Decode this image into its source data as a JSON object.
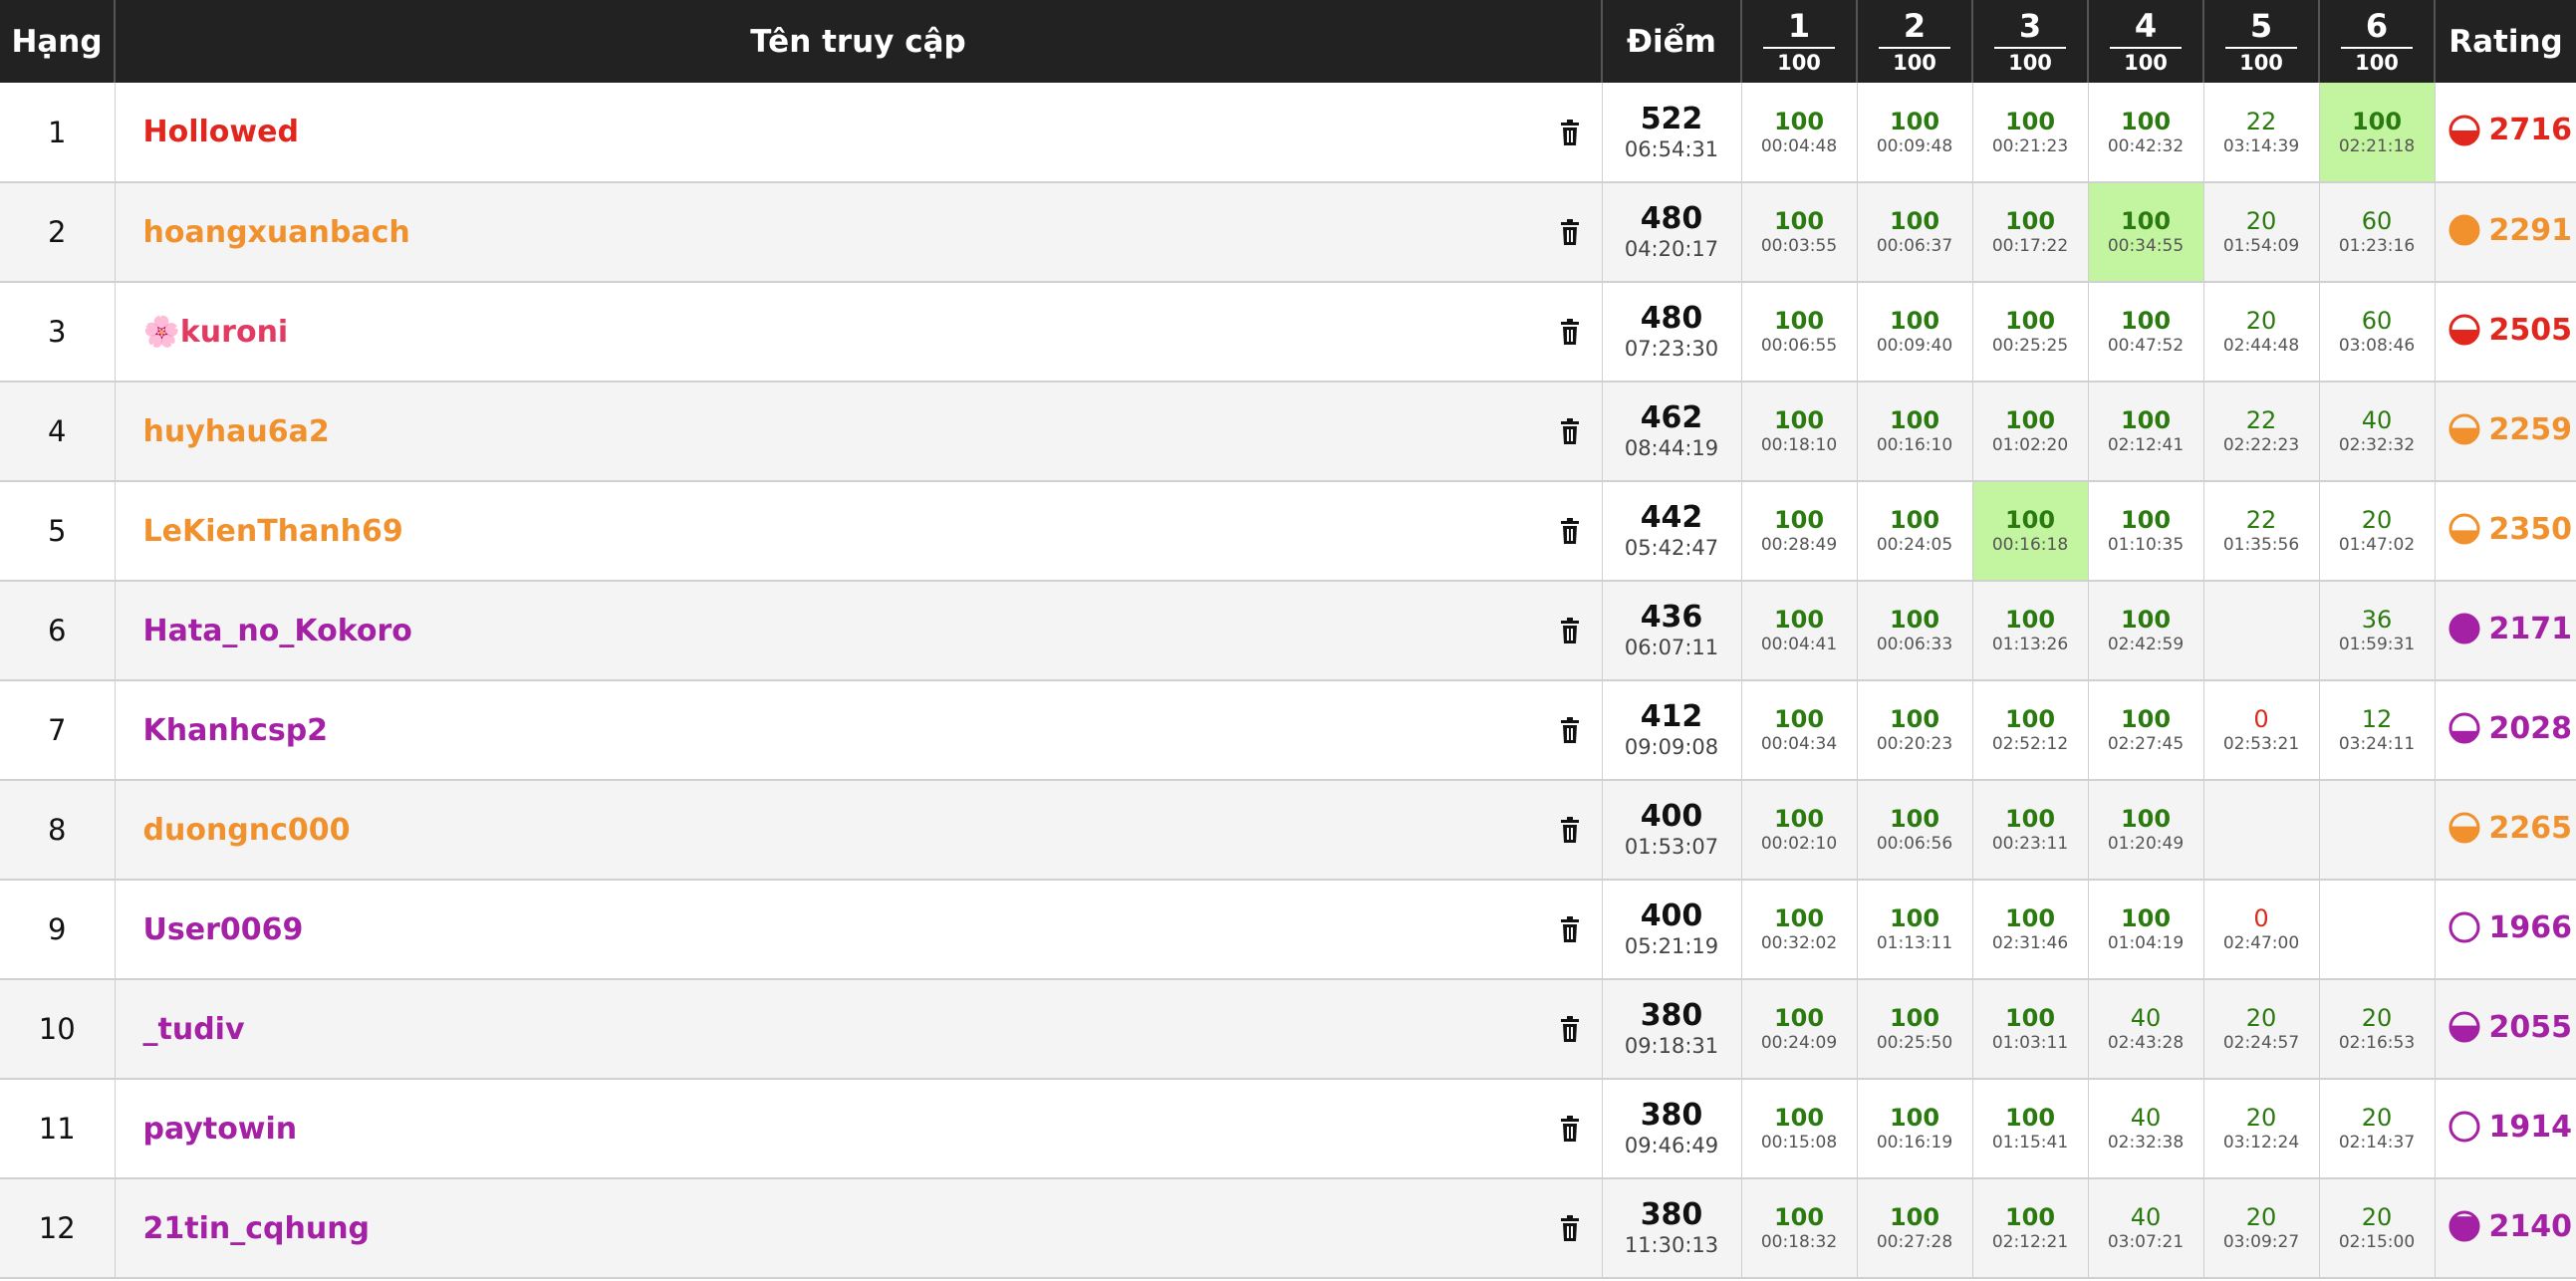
{
  "header": {
    "rank": "Hạng",
    "username": "Tên truy cập",
    "points": "Điểm",
    "problems": [
      {
        "num": "1",
        "points": "100"
      },
      {
        "num": "2",
        "points": "100"
      },
      {
        "num": "3",
        "points": "100"
      },
      {
        "num": "4",
        "points": "100"
      },
      {
        "num": "5",
        "points": "100"
      },
      {
        "num": "6",
        "points": "100"
      }
    ],
    "rating": "Rating"
  },
  "colors": {
    "red": "#e0261d",
    "orange": "#f0912e",
    "pink": "#e23b62",
    "purple": "#a420a5",
    "first_solve": "#c3f5a0",
    "header_bg": "#222222"
  },
  "icons": {
    "delete": "trash-icon"
  },
  "rows": [
    {
      "rank": "1",
      "username": "Hollowed",
      "color": "#e0261d",
      "score": "522",
      "time": "06:54:31",
      "problems": [
        {
          "score": "100",
          "time": "00:04:48"
        },
        {
          "score": "100",
          "time": "00:09:48"
        },
        {
          "score": "100",
          "time": "00:21:23"
        },
        {
          "score": "100",
          "time": "00:42:32"
        },
        {
          "score": "22",
          "time": "03:14:39"
        },
        {
          "score": "100",
          "time": "02:21:18",
          "first": true
        }
      ],
      "rating": "2716",
      "rating_color": "#e0261d",
      "rating_fill": 0.5
    },
    {
      "rank": "2",
      "username": "hoangxuanbach",
      "color": "#f0912e",
      "score": "480",
      "time": "04:20:17",
      "problems": [
        {
          "score": "100",
          "time": "00:03:55"
        },
        {
          "score": "100",
          "time": "00:06:37"
        },
        {
          "score": "100",
          "time": "00:17:22"
        },
        {
          "score": "100",
          "time": "00:34:55",
          "first": true
        },
        {
          "score": "20",
          "time": "01:54:09"
        },
        {
          "score": "60",
          "time": "01:23:16"
        }
      ],
      "rating": "2291",
      "rating_color": "#f0912e",
      "rating_fill": 1.0
    },
    {
      "rank": "3",
      "username": "kuroni",
      "prefix": "🌸",
      "color": "#e23b62",
      "score": "480",
      "time": "07:23:30",
      "problems": [
        {
          "score": "100",
          "time": "00:06:55"
        },
        {
          "score": "100",
          "time": "00:09:40"
        },
        {
          "score": "100",
          "time": "00:25:25"
        },
        {
          "score": "100",
          "time": "00:47:52"
        },
        {
          "score": "20",
          "time": "02:44:48"
        },
        {
          "score": "60",
          "time": "03:08:46"
        }
      ],
      "rating": "2505",
      "rating_color": "#e0261d",
      "rating_fill": 0.5
    },
    {
      "rank": "4",
      "username": "huyhau6a2",
      "color": "#f0912e",
      "score": "462",
      "time": "08:44:19",
      "problems": [
        {
          "score": "100",
          "time": "00:18:10"
        },
        {
          "score": "100",
          "time": "00:16:10"
        },
        {
          "score": "100",
          "time": "01:02:20"
        },
        {
          "score": "100",
          "time": "02:12:41"
        },
        {
          "score": "22",
          "time": "02:22:23"
        },
        {
          "score": "40",
          "time": "02:32:32"
        }
      ],
      "rating": "2259",
      "rating_color": "#f0912e",
      "rating_fill": 0.55
    },
    {
      "rank": "5",
      "username": "LeKienThanh69",
      "color": "#f0912e",
      "score": "442",
      "time": "05:42:47",
      "problems": [
        {
          "score": "100",
          "time": "00:28:49"
        },
        {
          "score": "100",
          "time": "00:24:05"
        },
        {
          "score": "100",
          "time": "00:16:18",
          "first": true
        },
        {
          "score": "100",
          "time": "01:10:35"
        },
        {
          "score": "22",
          "time": "01:35:56"
        },
        {
          "score": "20",
          "time": "01:47:02"
        }
      ],
      "rating": "2350",
      "rating_color": "#f0912e",
      "rating_fill": 0.45
    },
    {
      "rank": "6",
      "username": "Hata_no_Kokoro",
      "color": "#a420a5",
      "score": "436",
      "time": "06:07:11",
      "problems": [
        {
          "score": "100",
          "time": "00:04:41"
        },
        {
          "score": "100",
          "time": "00:06:33"
        },
        {
          "score": "100",
          "time": "01:13:26"
        },
        {
          "score": "100",
          "time": "02:42:59"
        },
        {
          "score": "",
          "time": ""
        },
        {
          "score": "36",
          "time": "01:59:31"
        }
      ],
      "rating": "2171",
      "rating_color": "#a420a5",
      "rating_fill": 1.0
    },
    {
      "rank": "7",
      "username": "Khanhcsp2",
      "color": "#a420a5",
      "score": "412",
      "time": "09:09:08",
      "problems": [
        {
          "score": "100",
          "time": "00:04:34"
        },
        {
          "score": "100",
          "time": "00:20:23"
        },
        {
          "score": "100",
          "time": "02:52:12"
        },
        {
          "score": "100",
          "time": "02:27:45"
        },
        {
          "score": "0",
          "time": "02:53:21"
        },
        {
          "score": "12",
          "time": "03:24:11"
        }
      ],
      "rating": "2028",
      "rating_color": "#a420a5",
      "rating_fill": 0.4
    },
    {
      "rank": "8",
      "username": "duongnc000",
      "color": "#f0912e",
      "score": "400",
      "time": "01:53:07",
      "problems": [
        {
          "score": "100",
          "time": "00:02:10"
        },
        {
          "score": "100",
          "time": "00:06:56"
        },
        {
          "score": "100",
          "time": "00:23:11"
        },
        {
          "score": "100",
          "time": "01:20:49"
        },
        {
          "score": "",
          "time": ""
        },
        {
          "score": "",
          "time": ""
        }
      ],
      "rating": "2265",
      "rating_color": "#f0912e",
      "rating_fill": 0.55
    },
    {
      "rank": "9",
      "username": "User0069",
      "color": "#a420a5",
      "score": "400",
      "time": "05:21:19",
      "problems": [
        {
          "score": "100",
          "time": "00:32:02"
        },
        {
          "score": "100",
          "time": "01:13:11"
        },
        {
          "score": "100",
          "time": "02:31:46"
        },
        {
          "score": "100",
          "time": "01:04:19"
        },
        {
          "score": "0",
          "time": "02:47:00"
        },
        {
          "score": "",
          "time": ""
        }
      ],
      "rating": "1966",
      "rating_color": "#a420a5",
      "rating_fill": 0.0
    },
    {
      "rank": "10",
      "username": "_tudiv",
      "color": "#a420a5",
      "score": "380",
      "time": "09:18:31",
      "problems": [
        {
          "score": "100",
          "time": "00:24:09"
        },
        {
          "score": "100",
          "time": "00:25:50"
        },
        {
          "score": "100",
          "time": "01:03:11"
        },
        {
          "score": "40",
          "time": "02:43:28"
        },
        {
          "score": "20",
          "time": "02:24:57"
        },
        {
          "score": "20",
          "time": "02:16:53"
        }
      ],
      "rating": "2055",
      "rating_color": "#a420a5",
      "rating_fill": 0.55
    },
    {
      "rank": "11",
      "username": "paytowin",
      "color": "#a420a5",
      "score": "380",
      "time": "09:46:49",
      "problems": [
        {
          "score": "100",
          "time": "00:15:08"
        },
        {
          "score": "100",
          "time": "00:16:19"
        },
        {
          "score": "100",
          "time": "01:15:41"
        },
        {
          "score": "40",
          "time": "02:32:38"
        },
        {
          "score": "20",
          "time": "03:12:24"
        },
        {
          "score": "20",
          "time": "02:14:37"
        }
      ],
      "rating": "1914",
      "rating_color": "#a420a5",
      "rating_fill": 0.0
    },
    {
      "rank": "12",
      "username": "21tin_cqhung",
      "color": "#a420a5",
      "score": "380",
      "time": "11:30:13",
      "problems": [
        {
          "score": "100",
          "time": "00:18:32"
        },
        {
          "score": "100",
          "time": "00:27:28"
        },
        {
          "score": "100",
          "time": "02:12:21"
        },
        {
          "score": "40",
          "time": "03:07:21"
        },
        {
          "score": "20",
          "time": "03:09:27"
        },
        {
          "score": "20",
          "time": "02:15:00"
        }
      ],
      "rating": "2140",
      "rating_color": "#a420a5",
      "rating_fill": 0.85
    }
  ]
}
